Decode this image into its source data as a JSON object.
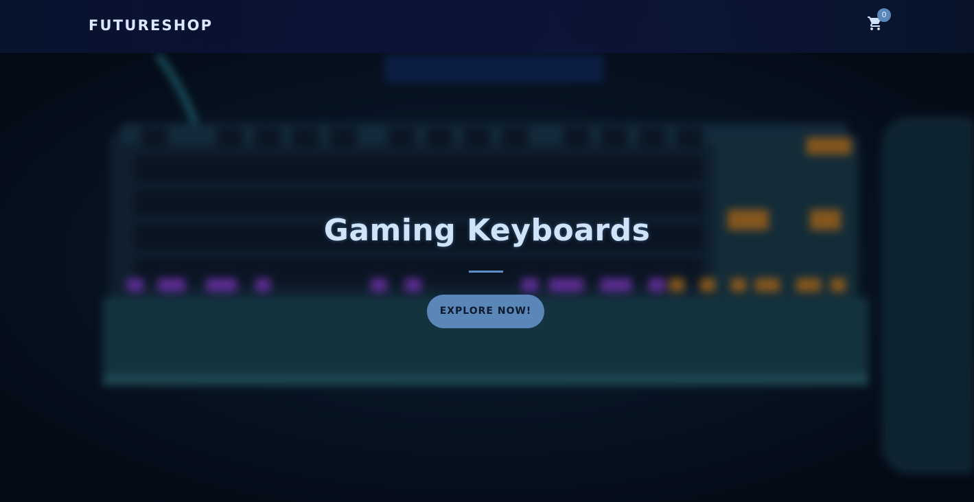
{
  "navbar": {
    "brand": "FUTURESHOP",
    "cart": {
      "icon": "shopping-cart-icon",
      "count": "0"
    }
  },
  "hero": {
    "title": "Gaming Keyboards",
    "cta_label": "EXPLORE NOW!"
  },
  "colors": {
    "accent": "#5a86b8",
    "brand_text": "#dbe9ff",
    "title_text": "#cfe4fb",
    "navbar_bg": "#0a1630"
  }
}
